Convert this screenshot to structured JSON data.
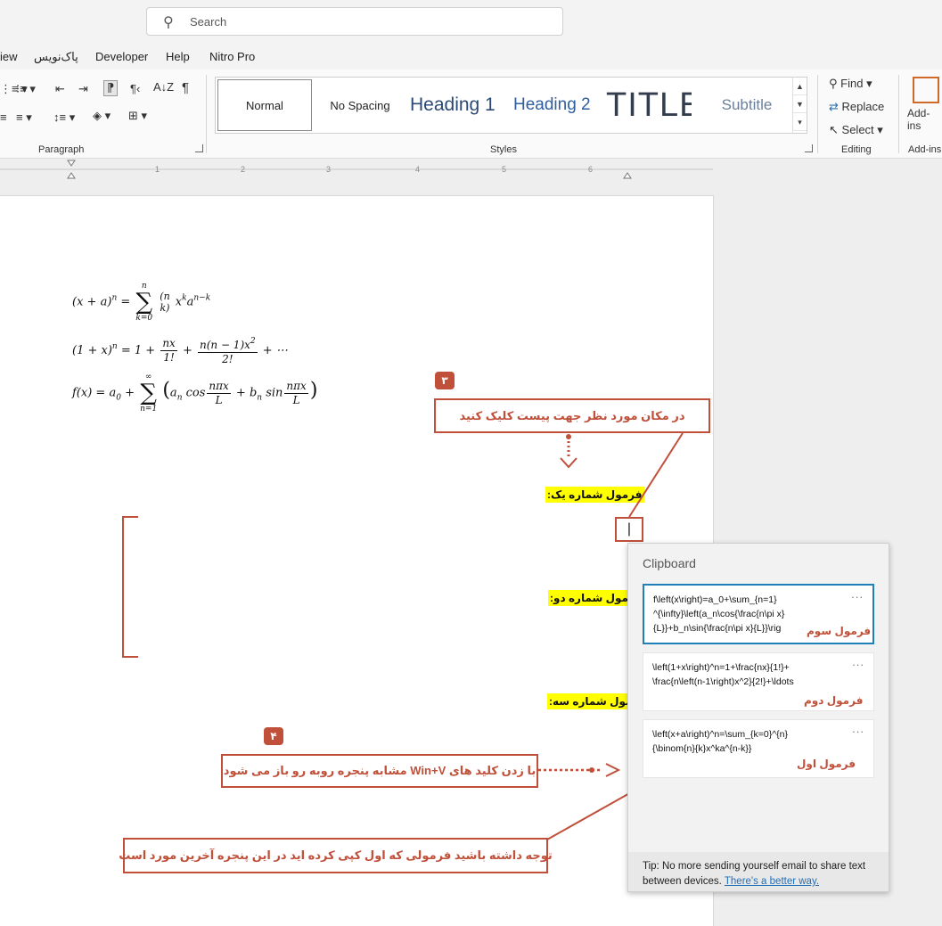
{
  "search": {
    "placeholder": "Search"
  },
  "menu": [
    "iew",
    "پاک‌نویس",
    "Developer",
    "Help",
    "Nitro Pro"
  ],
  "ribbon": {
    "paragraph_label": "Paragraph",
    "styles_label": "Styles",
    "editing_label": "Editing",
    "addins_label": "Add-ins",
    "addins_button": "Add-ins",
    "styles": [
      "Normal",
      "No Spacing",
      "Heading 1",
      "Heading 2",
      "TITLE",
      "Subtitle"
    ],
    "find": "Find",
    "replace": "Replace",
    "select": "Select"
  },
  "ruler_numbers": [
    "1",
    "1",
    "2",
    "3",
    "4",
    "5",
    "6"
  ],
  "document": {
    "label_one": "فرمول شماره یک:",
    "label_two": "فرمول شماره دو:",
    "label_three": "فرمول شماره سه:",
    "cursor_marker": "|"
  },
  "callouts": {
    "badge3": "۳",
    "badge4": "۴",
    "click_to_paste": "در مکان مورد نظر جهت پیست کلیک کنید",
    "winv": "با زدن کلید های Win+V مشابه پنجره روبه رو باز می شود",
    "note_order": "توجه داشته باشید فرمولی که اول کپی کرده اید در این پنجره آخرین مورد است"
  },
  "clipboard": {
    "title": "Clipboard",
    "items": [
      {
        "code": "f\\left(x\\right)=a_0+\\sum_{n=1}\n^{\\infty}\\left(a_n\\cos{\\frac{n\\pi x}\n{L}}+b_n\\sin{\\frac{n\\pi x}{L}}\\rig",
        "label": "فرمول سوم",
        "more": "..."
      },
      {
        "code": "\\left(1+x\\right)^n=1+\\frac{nx}{1!}+\n\\frac{n\\left(n-1\\right)x^2}{2!}+\\ldots",
        "label": "فرمول دوم",
        "more": "..."
      },
      {
        "code": "\\left(x+a\\right)^n=\\sum_{k=0}^{n}\n{\\binom{n}{k}x^ka^{n-k}}",
        "label": "فرمول اول",
        "more": "..."
      }
    ],
    "tip": "Tip: No more sending yourself email to share text between devices.",
    "tip_link": "There's a better way."
  },
  "colors": {
    "annotation": "#c0503a",
    "highlight": "#ffff00",
    "selection": "#1f7fb8"
  }
}
